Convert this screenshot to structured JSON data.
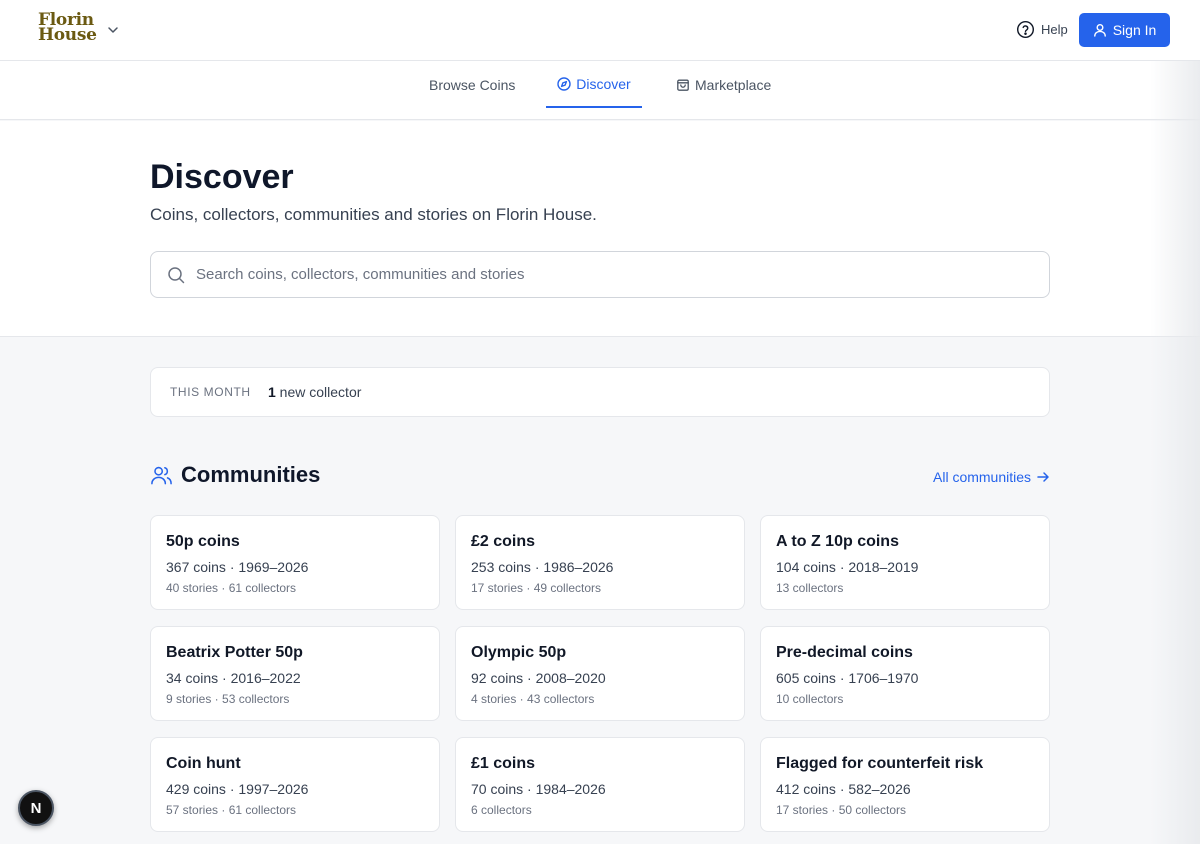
{
  "header": {
    "logo_line1": "Florin",
    "logo_line2": "House",
    "help_label": "Help",
    "signin_label": "Sign In"
  },
  "nav": {
    "tabs": [
      {
        "label": "Browse Coins",
        "active": false
      },
      {
        "label": "Discover",
        "active": true
      },
      {
        "label": "Marketplace",
        "active": false
      }
    ]
  },
  "hero": {
    "title": "Discover",
    "subtitle": "Coins, collectors, communities and stories on Florin House.",
    "search_placeholder": "Search coins, collectors, communities and stories"
  },
  "stats": {
    "label": "THIS MONTH",
    "count": "1",
    "text": " new collector"
  },
  "communities": {
    "heading": "Communities",
    "all_link": "All communities",
    "items": [
      {
        "title": "50p coins",
        "meta": "367 coins · 1969–2026",
        "sub": "40 stories · 61 collectors"
      },
      {
        "title": "£2 coins",
        "meta": "253 coins · 1986–2026",
        "sub": "17 stories · 49 collectors"
      },
      {
        "title": "A to Z 10p coins",
        "meta": "104 coins · 2018–2019",
        "sub": "13 collectors"
      },
      {
        "title": "Beatrix Potter 50p",
        "meta": "34 coins · 2016–2022",
        "sub": "9 stories · 53 collectors"
      },
      {
        "title": "Olympic 50p",
        "meta": "92 coins · 2008–2020",
        "sub": "4 stories · 43 collectors"
      },
      {
        "title": "Pre-decimal coins",
        "meta": "605 coins · 1706–1970",
        "sub": "10 collectors"
      },
      {
        "title": "Coin hunt",
        "meta": "429 coins · 1997–2026",
        "sub": "57 stories · 61 collectors"
      },
      {
        "title": "£1 coins",
        "meta": "70 coins · 1984–2026",
        "sub": "6 collectors"
      },
      {
        "title": "Flagged for counterfeit risk",
        "meta": "412 coins · 582–2026",
        "sub": "17 stories · 50 collectors"
      }
    ]
  },
  "floating_badge": "N",
  "colors": {
    "accent": "#2563eb",
    "logo": "#6b5a12",
    "background": "#f6f7f9"
  }
}
